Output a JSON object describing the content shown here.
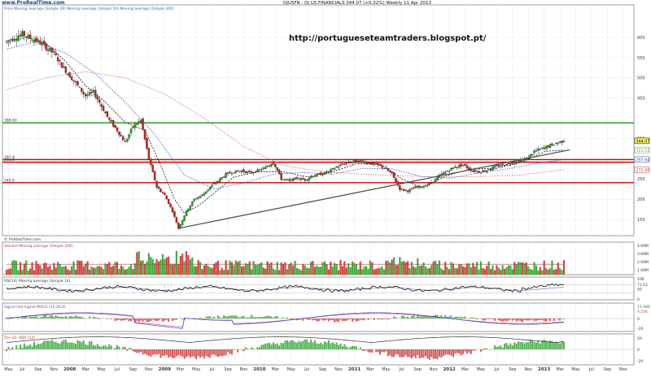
{
  "header": {
    "logo_text": "www.ProRealTime.com",
    "instrument_title": "DJUSFN - DJ US FINANCIALS   344.07 (+0.32%)   Weekly 11 Apr 2013",
    "main_legend": "Price Moving average (Simple 20) Moving average (Simple 50) Moving average (Simple 200)",
    "watermark": "http://portugueseteamtraders.blogspot.pt/"
  },
  "price_panel": {
    "ylim": [
      110,
      680
    ],
    "y_ticks": [
      {
        "value": 600,
        "label": "600"
      },
      {
        "value": 550,
        "label": "550"
      },
      {
        "value": 500,
        "label": "500"
      },
      {
        "value": 450,
        "label": "450"
      },
      {
        "value": 350,
        "label": "350"
      },
      {
        "value": 300,
        "label": "300"
      },
      {
        "value": 250,
        "label": "250"
      },
      {
        "value": 200,
        "label": "200"
      },
      {
        "value": 150,
        "label": "150"
      }
    ],
    "price_tags": [
      {
        "label": "344.07",
        "value": 344.07,
        "color": "#000000",
        "bg": "#ffff66"
      },
      {
        "label": "321.52",
        "value": 321.52,
        "color": "#6f8f4f",
        "bg": "#ffffff"
      },
      {
        "label": "297.94",
        "value": 297.94,
        "color": "#3a4fa0",
        "bg": "#ffffff"
      },
      {
        "label": "272.98",
        "value": 272.98,
        "color": "#c0504d",
        "bg": "#ffffff"
      }
    ],
    "level_labels": [
      {
        "label": "388.60",
        "value": 388.6
      },
      {
        "label": "297.8",
        "value": 297.8
      },
      {
        "label": "291.4",
        "value": 291.4
      },
      {
        "label": "240.8",
        "value": 240.8
      }
    ],
    "copyright": "© ProRealTime.com"
  },
  "volume_panel": {
    "legend": "Volume Moving average (Simple 200)",
    "y_labels": [
      "4.00M",
      "3.00M",
      "2.00M",
      "1.00M"
    ]
  },
  "rsi_panel": {
    "legend": "RSI(14) Moving average (Simple 14)",
    "y_labels": [
      "100",
      "71.12",
      "50",
      "0"
    ]
  },
  "macd_panel": {
    "legend": "Signal line  Signal MACD (12,26,9)",
    "y_labels": [
      "11.086",
      "9.556",
      "0",
      "-20"
    ]
  },
  "adx_panel": {
    "legend": "DI+  DI-  ADX (14)",
    "y_labels": [
      "20",
      "0",
      "-20"
    ]
  },
  "x_axis": {
    "labels": [
      {
        "t": 0.02,
        "label": "May"
      },
      {
        "t": 0.16,
        "label": "Jul"
      },
      {
        "t": 0.32,
        "label": "Sep"
      },
      {
        "t": 0.48,
        "label": "Nov"
      },
      {
        "t": 0.64,
        "label": "2008",
        "bold": true
      },
      {
        "t": 0.8,
        "label": "Mar"
      },
      {
        "t": 0.96,
        "label": "May"
      },
      {
        "t": 1.12,
        "label": "Jul"
      },
      {
        "t": 1.28,
        "label": "Sep"
      },
      {
        "t": 1.44,
        "label": "Nov"
      },
      {
        "t": 1.6,
        "label": "2009",
        "bold": true
      },
      {
        "t": 1.76,
        "label": "Mar"
      },
      {
        "t": 1.92,
        "label": "May"
      },
      {
        "t": 2.08,
        "label": "Jul"
      },
      {
        "t": 2.24,
        "label": "Sep"
      },
      {
        "t": 2.4,
        "label": "Nov"
      },
      {
        "t": 2.56,
        "label": "2010",
        "bold": true
      },
      {
        "t": 2.72,
        "label": "Mar"
      },
      {
        "t": 2.88,
        "label": "May"
      },
      {
        "t": 3.04,
        "label": "Jul"
      },
      {
        "t": 3.2,
        "label": "Sep"
      },
      {
        "t": 3.36,
        "label": "Nov"
      },
      {
        "t": 3.52,
        "label": "2011",
        "bold": true
      },
      {
        "t": 3.68,
        "label": "Mar"
      },
      {
        "t": 3.84,
        "label": "May"
      },
      {
        "t": 4.0,
        "label": "Jul"
      },
      {
        "t": 4.16,
        "label": "Sep"
      },
      {
        "t": 4.32,
        "label": "Nov"
      },
      {
        "t": 4.48,
        "label": "2012",
        "bold": true
      },
      {
        "t": 4.64,
        "label": "Mar"
      },
      {
        "t": 4.8,
        "label": "May"
      },
      {
        "t": 4.96,
        "label": "Jul"
      },
      {
        "t": 5.12,
        "label": "Sep"
      },
      {
        "t": 5.28,
        "label": "Nov"
      },
      {
        "t": 5.44,
        "label": "2013",
        "bold": true
      },
      {
        "t": 5.6,
        "label": "Mar"
      },
      {
        "t": 5.76,
        "label": "May"
      },
      {
        "t": 5.92,
        "label": "Jul"
      },
      {
        "t": 6.08,
        "label": "Sep"
      },
      {
        "t": 6.24,
        "label": "Nov"
      }
    ]
  },
  "chart_data": {
    "type": "line",
    "price_series": [
      {
        "t": 0.0,
        "value": 590
      },
      {
        "t": 0.08,
        "value": 600
      },
      {
        "t": 0.16,
        "value": 608
      },
      {
        "t": 0.24,
        "value": 598
      },
      {
        "t": 0.32,
        "value": 590
      },
      {
        "t": 0.4,
        "value": 575
      },
      {
        "t": 0.48,
        "value": 560
      },
      {
        "t": 0.56,
        "value": 530
      },
      {
        "t": 0.64,
        "value": 505
      },
      {
        "t": 0.72,
        "value": 480
      },
      {
        "t": 0.8,
        "value": 455
      },
      {
        "t": 0.88,
        "value": 465
      },
      {
        "t": 0.96,
        "value": 430
      },
      {
        "t": 1.04,
        "value": 395
      },
      {
        "t": 1.12,
        "value": 370
      },
      {
        "t": 1.2,
        "value": 340
      },
      {
        "t": 1.28,
        "value": 380
      },
      {
        "t": 1.36,
        "value": 395
      },
      {
        "t": 1.44,
        "value": 300
      },
      {
        "t": 1.52,
        "value": 230
      },
      {
        "t": 1.6,
        "value": 210
      },
      {
        "t": 1.68,
        "value": 170
      },
      {
        "t": 1.74,
        "value": 128
      },
      {
        "t": 1.82,
        "value": 170
      },
      {
        "t": 1.9,
        "value": 200
      },
      {
        "t": 1.98,
        "value": 210
      },
      {
        "t": 2.06,
        "value": 230
      },
      {
        "t": 2.14,
        "value": 245
      },
      {
        "t": 2.22,
        "value": 262
      },
      {
        "t": 2.3,
        "value": 268
      },
      {
        "t": 2.38,
        "value": 270
      },
      {
        "t": 2.46,
        "value": 265
      },
      {
        "t": 2.54,
        "value": 270
      },
      {
        "t": 2.62,
        "value": 278
      },
      {
        "t": 2.7,
        "value": 292
      },
      {
        "t": 2.78,
        "value": 250
      },
      {
        "t": 2.86,
        "value": 245
      },
      {
        "t": 2.94,
        "value": 252
      },
      {
        "t": 3.02,
        "value": 248
      },
      {
        "t": 3.1,
        "value": 258
      },
      {
        "t": 3.18,
        "value": 262
      },
      {
        "t": 3.26,
        "value": 268
      },
      {
        "t": 3.34,
        "value": 280
      },
      {
        "t": 3.42,
        "value": 288
      },
      {
        "t": 3.5,
        "value": 293
      },
      {
        "t": 3.58,
        "value": 295
      },
      {
        "t": 3.66,
        "value": 290
      },
      {
        "t": 3.74,
        "value": 285
      },
      {
        "t": 3.82,
        "value": 278
      },
      {
        "t": 3.9,
        "value": 262
      },
      {
        "t": 3.98,
        "value": 225
      },
      {
        "t": 4.06,
        "value": 220
      },
      {
        "t": 4.14,
        "value": 230
      },
      {
        "t": 4.22,
        "value": 232
      },
      {
        "t": 4.3,
        "value": 240
      },
      {
        "t": 4.38,
        "value": 258
      },
      {
        "t": 4.46,
        "value": 270
      },
      {
        "t": 4.54,
        "value": 280
      },
      {
        "t": 4.62,
        "value": 285
      },
      {
        "t": 4.7,
        "value": 272
      },
      {
        "t": 4.78,
        "value": 268
      },
      {
        "t": 4.86,
        "value": 272
      },
      {
        "t": 4.94,
        "value": 280
      },
      {
        "t": 5.02,
        "value": 285
      },
      {
        "t": 5.1,
        "value": 290
      },
      {
        "t": 5.18,
        "value": 295
      },
      {
        "t": 5.26,
        "value": 300
      },
      {
        "t": 5.34,
        "value": 318
      },
      {
        "t": 5.42,
        "value": 325
      },
      {
        "t": 5.5,
        "value": 333
      },
      {
        "t": 5.58,
        "value": 340
      },
      {
        "t": 5.64,
        "value": 344.07
      }
    ],
    "sma20_series": [
      {
        "t": 0.0,
        "value": 585
      },
      {
        "t": 0.2,
        "value": 600
      },
      {
        "t": 0.4,
        "value": 585
      },
      {
        "t": 0.6,
        "value": 540
      },
      {
        "t": 0.8,
        "value": 480
      },
      {
        "t": 1.0,
        "value": 440
      },
      {
        "t": 1.2,
        "value": 390
      },
      {
        "t": 1.4,
        "value": 370
      },
      {
        "t": 1.55,
        "value": 290
      },
      {
        "t": 1.7,
        "value": 200
      },
      {
        "t": 1.8,
        "value": 165
      },
      {
        "t": 1.95,
        "value": 185
      },
      {
        "t": 2.1,
        "value": 215
      },
      {
        "t": 2.3,
        "value": 255
      },
      {
        "t": 2.55,
        "value": 268
      },
      {
        "t": 2.8,
        "value": 268
      },
      {
        "t": 3.05,
        "value": 255
      },
      {
        "t": 3.3,
        "value": 268
      },
      {
        "t": 3.55,
        "value": 288
      },
      {
        "t": 3.8,
        "value": 285
      },
      {
        "t": 4.0,
        "value": 250
      },
      {
        "t": 4.2,
        "value": 228
      },
      {
        "t": 4.45,
        "value": 258
      },
      {
        "t": 4.7,
        "value": 275
      },
      {
        "t": 4.95,
        "value": 276
      },
      {
        "t": 5.2,
        "value": 290
      },
      {
        "t": 5.45,
        "value": 318
      },
      {
        "t": 5.64,
        "value": 321.52
      }
    ],
    "sma50_series": [
      {
        "t": 0.0,
        "value": 570
      },
      {
        "t": 0.3,
        "value": 590
      },
      {
        "t": 0.6,
        "value": 560
      },
      {
        "t": 0.9,
        "value": 510
      },
      {
        "t": 1.2,
        "value": 440
      },
      {
        "t": 1.5,
        "value": 360
      },
      {
        "t": 1.8,
        "value": 260
      },
      {
        "t": 2.1,
        "value": 225
      },
      {
        "t": 2.4,
        "value": 240
      },
      {
        "t": 2.7,
        "value": 262
      },
      {
        "t": 3.0,
        "value": 266
      },
      {
        "t": 3.3,
        "value": 262
      },
      {
        "t": 3.6,
        "value": 276
      },
      {
        "t": 3.9,
        "value": 275
      },
      {
        "t": 4.2,
        "value": 256
      },
      {
        "t": 4.5,
        "value": 252
      },
      {
        "t": 4.8,
        "value": 266
      },
      {
        "t": 5.1,
        "value": 276
      },
      {
        "t": 5.4,
        "value": 290
      },
      {
        "t": 5.64,
        "value": 297.94
      }
    ],
    "sma200_series": [
      {
        "t": 0.0,
        "value": 470
      },
      {
        "t": 0.4,
        "value": 500
      },
      {
        "t": 0.8,
        "value": 515
      },
      {
        "t": 1.2,
        "value": 500
      },
      {
        "t": 1.6,
        "value": 460
      },
      {
        "t": 2.0,
        "value": 400
      },
      {
        "t": 2.4,
        "value": 330
      },
      {
        "t": 2.8,
        "value": 283
      },
      {
        "t": 3.2,
        "value": 268
      },
      {
        "t": 3.6,
        "value": 262
      },
      {
        "t": 4.0,
        "value": 258
      },
      {
        "t": 4.4,
        "value": 255
      },
      {
        "t": 4.8,
        "value": 256
      },
      {
        "t": 5.2,
        "value": 260
      },
      {
        "t": 5.64,
        "value": 272.98
      }
    ],
    "horizontal_levels": [
      {
        "value": 388.6,
        "color": "#1f8f1f"
      },
      {
        "value": 297.8,
        "color": "#d40000"
      },
      {
        "value": 291.4,
        "color": "#d40000"
      },
      {
        "value": 240.8,
        "color": "#d40000"
      }
    ],
    "trendline": {
      "from": {
        "t": 1.74,
        "value": 128
      },
      "to": {
        "t": 5.7,
        "value": 322
      }
    },
    "volume_mean": 1.5
  }
}
